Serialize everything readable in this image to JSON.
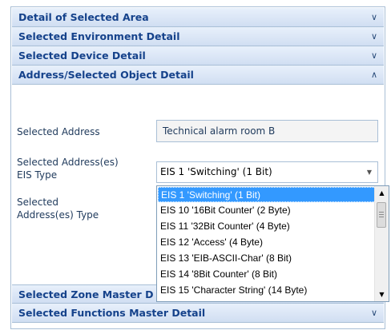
{
  "sections": {
    "detail_area": {
      "title": "Detail of Selected Area",
      "state": "collapsed"
    },
    "environment": {
      "title": "Selected Environment Detail",
      "state": "collapsed"
    },
    "device": {
      "title": "Selected Device Detail",
      "state": "collapsed"
    },
    "address": {
      "title": "Address/Selected Object Detail",
      "state": "expanded"
    },
    "zone": {
      "title": "Selected Zone Master D"
    },
    "functions": {
      "title": "Selected Functions Master Detail",
      "state": "collapsed"
    }
  },
  "form": {
    "selected_address_label": "Selected Address",
    "selected_address_value": "Technical alarm room B",
    "eis_type_label_line1": "Selected Address(es)",
    "eis_type_label_line2": "EIS Type",
    "eis_type_value": "EIS 1 'Switching' (1 Bit)",
    "type_label_line1": "Selected",
    "type_label_line2": "Address(es) Type"
  },
  "dropdown": {
    "options": [
      "EIS 1 'Switching' (1 Bit)",
      "EIS 10 '16Bit Counter' (2 Byte)",
      "EIS 11 '32Bit Counter' (4 Byte)",
      "EIS 12 'Access' (4 Byte)",
      "EIS 13 'EIB-ASCII-Char' (8 Bit)",
      "EIS 14 '8Bit Counter' (8 Bit)",
      "EIS 15 'Character String' (14 Byte)"
    ],
    "selected_index": 0
  },
  "icons": {
    "collapse": "chevron-double-down",
    "expand": "chevron-double-up"
  },
  "colors": {
    "header_text": "#15428b",
    "selected_option_bg": "#3399ff"
  }
}
